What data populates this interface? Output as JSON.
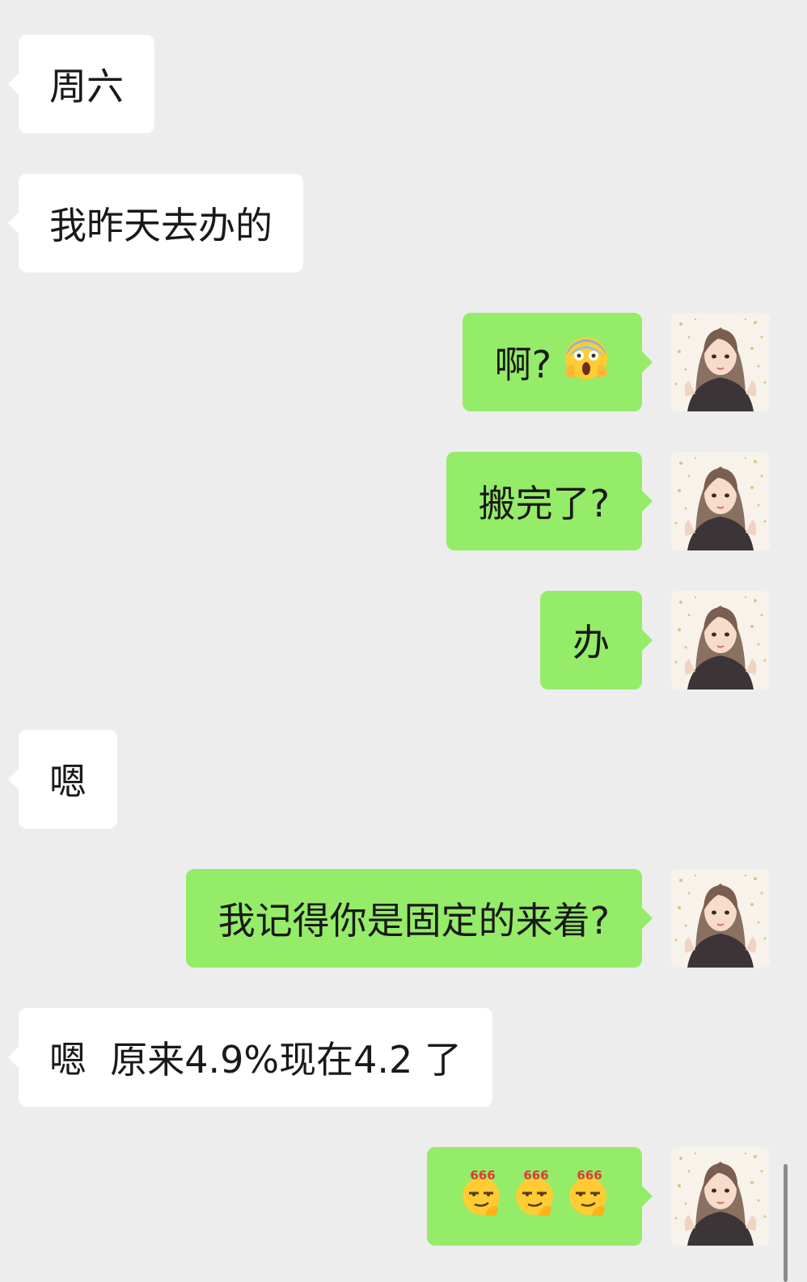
{
  "messages": [
    {
      "side": "in",
      "text": "周六"
    },
    {
      "side": "in",
      "text": "我昨天去办的"
    },
    {
      "side": "out",
      "text": "啊?",
      "emoji": "screaming-face-emoji"
    },
    {
      "side": "out",
      "text": "搬完了?"
    },
    {
      "side": "out",
      "text": "办"
    },
    {
      "side": "in",
      "text": "嗯"
    },
    {
      "side": "out",
      "text": "我记得你是固定的来着?"
    },
    {
      "side": "in",
      "text": "嗯  原来4.9%现在4.2 了"
    },
    {
      "side": "out",
      "stickers": [
        "666",
        "666",
        "666"
      ]
    }
  ],
  "colors": {
    "background": "#ededed",
    "incoming_bubble": "#ffffff",
    "outgoing_bubble": "#95ec69",
    "text": "#191919"
  },
  "icons": {
    "avatar": "user-avatar-illustration",
    "sticker": "smirk-666-emoji"
  }
}
